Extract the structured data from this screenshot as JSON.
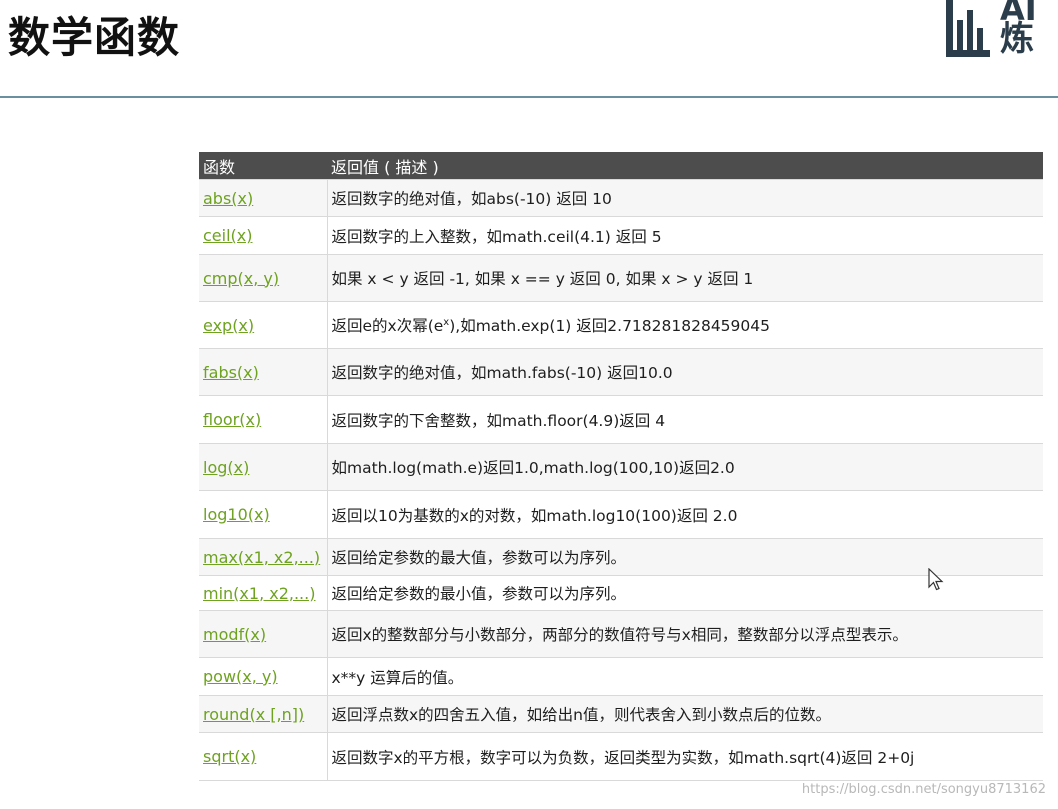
{
  "slide": {
    "title": "数学函数"
  },
  "logo": {
    "line1": "AI",
    "line2": "炼"
  },
  "table": {
    "headers": [
      "函数",
      "返回值 ( 描述 )"
    ],
    "rows": [
      {
        "fn": "abs(x)",
        "desc": "返回数字的绝对值，如abs(-10) 返回 10"
      },
      {
        "fn": "ceil(x)",
        "desc": "返回数字的上入整数，如math.ceil(4.1) 返回 5"
      },
      {
        "fn": "cmp(x, y)",
        "desc": "如果 x < y 返回 -1, 如果 x == y 返回 0, 如果 x > y 返回 1"
      },
      {
        "fn": "exp(x)",
        "desc_pre": "返回e的x次幂(e",
        "desc_sup": "x",
        "desc_post": "),如math.exp(1) 返回2.718281828459045"
      },
      {
        "fn": "fabs(x)",
        "desc": "返回数字的绝对值，如math.fabs(-10) 返回10.0"
      },
      {
        "fn": "floor(x)",
        "desc": "返回数字的下舍整数，如math.floor(4.9)返回 4"
      },
      {
        "fn": "log(x)",
        "desc": "如math.log(math.e)返回1.0,math.log(100,10)返回2.0"
      },
      {
        "fn": "log10(x)",
        "desc": "返回以10为基数的x的对数，如math.log10(100)返回 2.0"
      },
      {
        "fn": "max(x1, x2,...)",
        "desc": "返回给定参数的最大值，参数可以为序列。"
      },
      {
        "fn": "min(x1, x2,...)",
        "desc": "返回给定参数的最小值，参数可以为序列。"
      },
      {
        "fn": "modf(x)",
        "desc": "返回x的整数部分与小数部分，两部分的数值符号与x相同，整数部分以浮点型表示。"
      },
      {
        "fn": "pow(x, y)",
        "desc": "x**y 运算后的值。"
      },
      {
        "fn": "round(x [,n])",
        "desc": "返回浮点数x的四舍五入值，如给出n值，则代表舍入到小数点后的位数。"
      },
      {
        "fn": "sqrt(x)",
        "desc": "返回数字x的平方根，数字可以为负数，返回类型为实数，如math.sqrt(4)返回 2+0j"
      }
    ]
  },
  "watermark": "https://blog.csdn.net/songyu8713162",
  "colors": {
    "header_bg": "#4d4d4d",
    "link": "#6ea220",
    "rule": "#6a8fa0",
    "logo": "#2b3d4a"
  }
}
